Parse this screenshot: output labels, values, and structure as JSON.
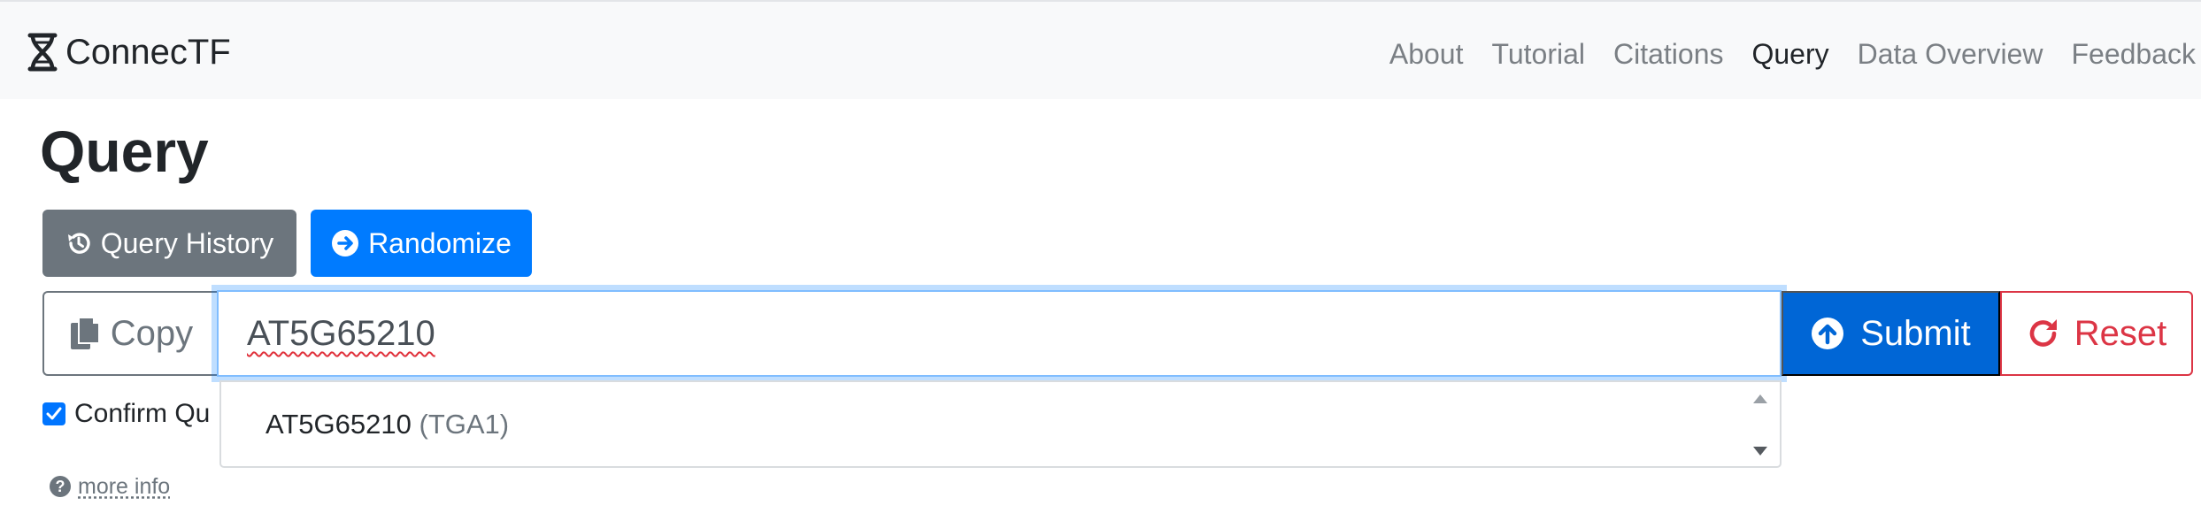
{
  "navbar": {
    "brand": "ConnecTF",
    "links": [
      {
        "label": "About",
        "active": false
      },
      {
        "label": "Tutorial",
        "active": false
      },
      {
        "label": "Citations",
        "active": false
      },
      {
        "label": "Query",
        "active": true
      },
      {
        "label": "Data Overview",
        "active": false
      },
      {
        "label": "Feedback",
        "active": false
      }
    ]
  },
  "page": {
    "title": "Query"
  },
  "actions": {
    "history_label": "Query History",
    "randomize_label": "Randomize"
  },
  "query_bar": {
    "copy_label": "Copy",
    "value": "AT5G65210",
    "submit_label": "Submit",
    "reset_label": "Reset"
  },
  "confirm": {
    "label": "Confirm Qu",
    "checked": true
  },
  "more_info": {
    "label": "more info"
  },
  "autocomplete": {
    "items": [
      {
        "id": "AT5G65210",
        "alias": "(TGA1)"
      }
    ]
  },
  "colors": {
    "primary": "#007bff",
    "submit": "#0066d6",
    "secondary": "#6c757d",
    "danger": "#dc3545",
    "navbar_bg": "#f8f9fa"
  },
  "icons": {
    "brand": "dna-icon",
    "history": "history-icon",
    "randomize": "arrow-circle-right-icon",
    "copy": "copy-icon",
    "submit": "arrow-circle-up-icon",
    "reset": "redo-icon",
    "help": "question-circle-icon"
  }
}
